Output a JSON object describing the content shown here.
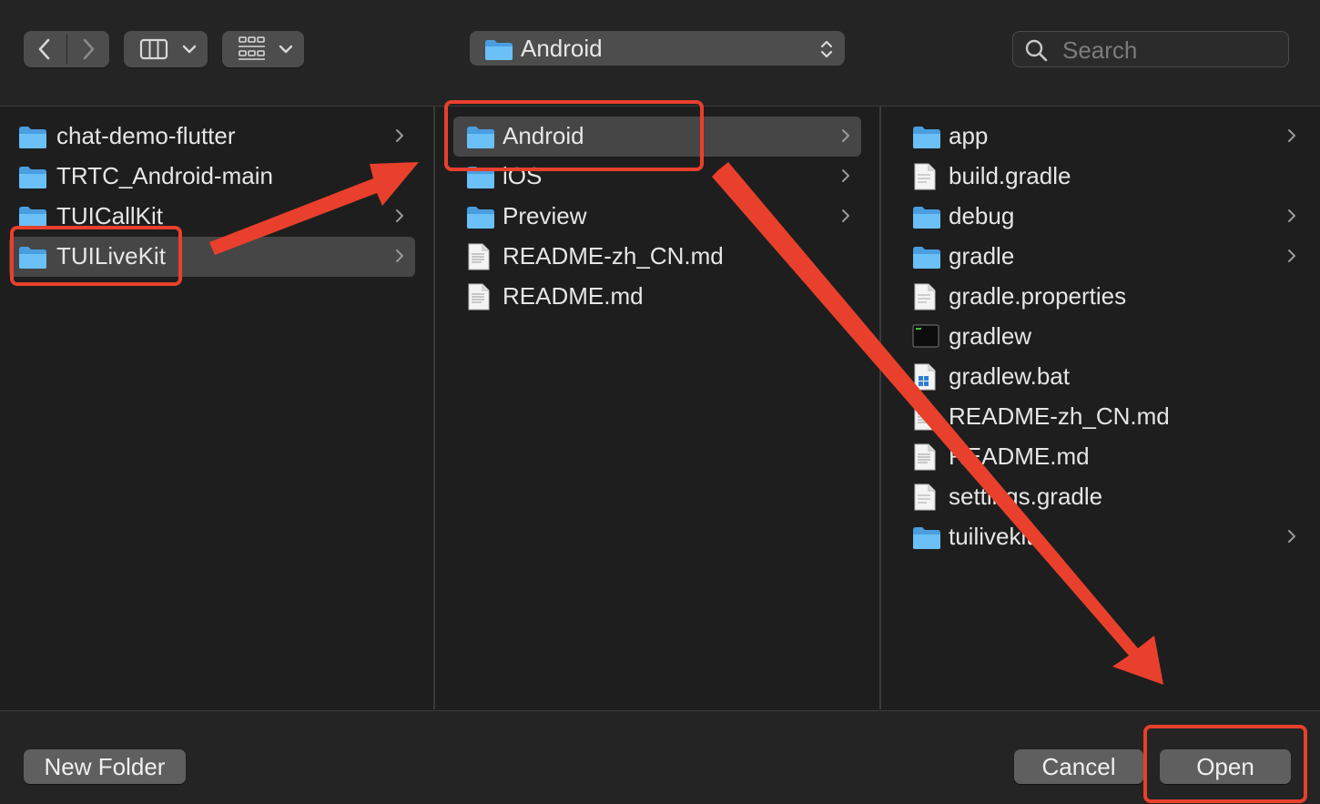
{
  "toolbar": {
    "path_label": "Android",
    "search_placeholder": "Search"
  },
  "columns": [
    {
      "items": [
        {
          "name": "chat-demo-flutter",
          "type": "folder",
          "has_children": true
        },
        {
          "name": "TRTC_Android-main",
          "type": "folder",
          "has_children": false
        },
        {
          "name": "TUICallKit",
          "type": "folder",
          "has_children": true
        },
        {
          "name": "TUILiveKit",
          "type": "folder",
          "has_children": true,
          "selected": true
        }
      ]
    },
    {
      "items": [
        {
          "name": "Android",
          "type": "folder",
          "has_children": true,
          "selected": true
        },
        {
          "name": "iOS",
          "type": "folder",
          "has_children": true
        },
        {
          "name": "Preview",
          "type": "folder",
          "has_children": true
        },
        {
          "name": "README-zh_CN.md",
          "type": "markdown",
          "has_children": false
        },
        {
          "name": "README.md",
          "type": "markdown",
          "has_children": false
        }
      ]
    },
    {
      "items": [
        {
          "name": "app",
          "type": "folder",
          "has_children": true
        },
        {
          "name": "build.gradle",
          "type": "document",
          "has_children": false
        },
        {
          "name": "debug",
          "type": "folder",
          "has_children": true
        },
        {
          "name": "gradle",
          "type": "folder",
          "has_children": true
        },
        {
          "name": "gradle.properties",
          "type": "document",
          "has_children": false
        },
        {
          "name": "gradlew",
          "type": "executable",
          "has_children": false
        },
        {
          "name": "gradlew.bat",
          "type": "bat",
          "has_children": false
        },
        {
          "name": "README-zh_CN.md",
          "type": "markdown",
          "has_children": false
        },
        {
          "name": "README.md",
          "type": "markdown",
          "has_children": false
        },
        {
          "name": "settings.gradle",
          "type": "document",
          "has_children": false
        },
        {
          "name": "tuilivekit",
          "type": "folder",
          "has_children": true
        }
      ]
    }
  ],
  "buttons": {
    "new_folder": "New Folder",
    "cancel": "Cancel",
    "open": "Open"
  },
  "colors": {
    "annotation": "#e8402c",
    "folder": "#5fb4ef",
    "selection": "#464646"
  }
}
